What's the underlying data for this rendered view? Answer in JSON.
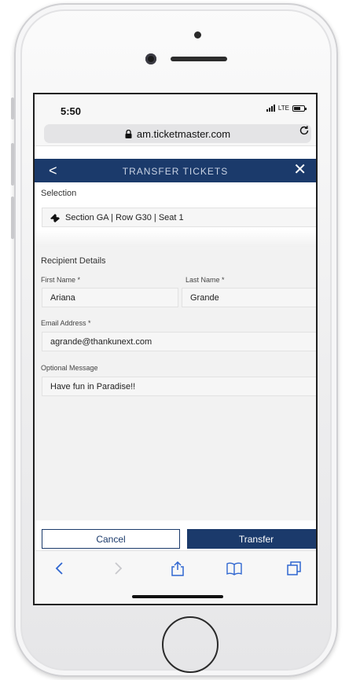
{
  "status": {
    "time": "5:50",
    "network": "LTE"
  },
  "browser": {
    "url": "am.ticketmaster.com"
  },
  "header": {
    "back": "<",
    "title": "TRANSFER TICKETS",
    "close": "✕"
  },
  "selection": {
    "label": "Selection",
    "ticket": "Section GA | Row G30 | Seat 1"
  },
  "recipient": {
    "label": "Recipient Details",
    "first_name_label": "First Name *",
    "first_name_value": "Ariana",
    "last_name_label": "Last Name *",
    "last_name_value": "Grande",
    "email_label": "Email Address *",
    "email_value": "agrande@thankunext.com",
    "message_label": "Optional Message",
    "message_value": "Have fun in Paradise!!"
  },
  "actions": {
    "cancel_label": "Cancel",
    "transfer_label": "Transfer"
  },
  "toolbar": {
    "icons": [
      "back-icon",
      "forward-icon",
      "share-icon",
      "bookmarks-icon",
      "tabs-icon"
    ]
  },
  "colors": {
    "brand": "#1b3a6b",
    "background": "#f2f2f2"
  }
}
